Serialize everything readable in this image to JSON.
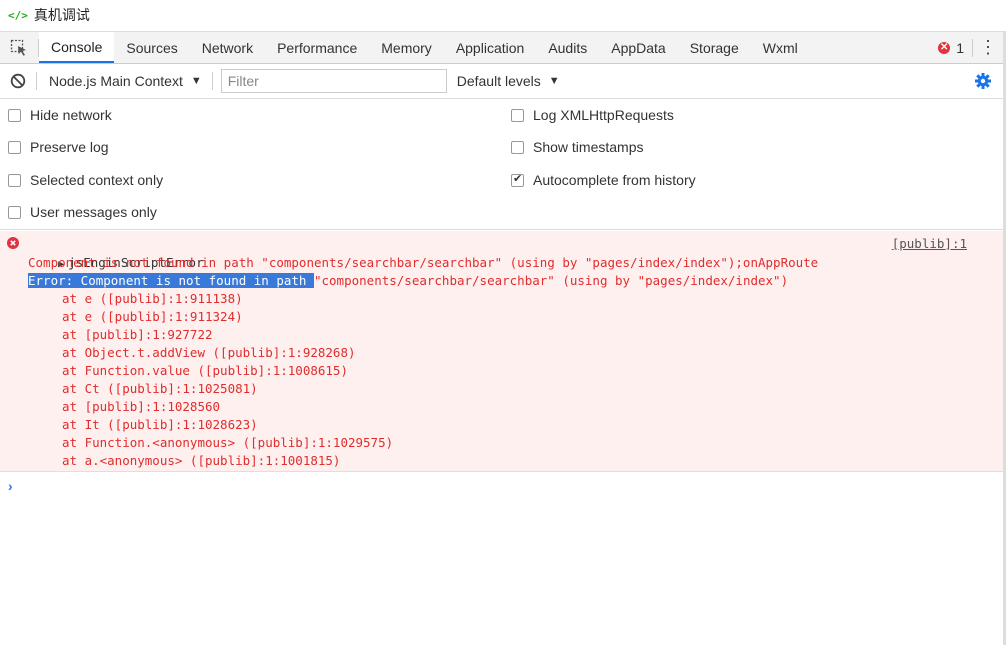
{
  "window": {
    "title": "真机调试",
    "logo": "</>"
  },
  "tabs": [
    "Console",
    "Sources",
    "Network",
    "Performance",
    "Memory",
    "Application",
    "Audits",
    "AppData",
    "Storage",
    "Wxml"
  ],
  "error_count": "1",
  "toolbar": {
    "context": "Node.js Main Context",
    "filter_placeholder": "Filter",
    "levels": "Default levels"
  },
  "settings": {
    "hide_network": "Hide network",
    "preserve_log": "Preserve log",
    "selected_context_only": "Selected context only",
    "user_messages_only": "User messages only",
    "log_xhr": "Log XMLHttpRequests",
    "show_timestamps": "Show timestamps",
    "autocomplete": "Autocomplete from history",
    "autocomplete_checked": true
  },
  "error": {
    "title": "jsEnginScriptError",
    "source": "[publib]:1",
    "message": "Component is not found in path \"components/searchbar/searchbar\" (using by \"pages/index/index\");onAppRoute",
    "selected_text": "Error: Component is not found in path ",
    "rest_text": "\"components/searchbar/searchbar\" (using by \"pages/index/index\")",
    "stack": [
      "at e ([publib]:1:911138)",
      "at e ([publib]:1:911324)",
      "at [publib]:1:927722",
      "at Object.t.addView ([publib]:1:928268)",
      "at Function.value ([publib]:1:1008615)",
      "at Ct ([publib]:1:1025081)",
      "at [publib]:1:1028560",
      "at It ([publib]:1:1028623)",
      "at Function.<anonymous> ([publib]:1:1029575)",
      "at a.<anonymous> ([publib]:1:1001815)"
    ]
  },
  "prompt": "›"
}
